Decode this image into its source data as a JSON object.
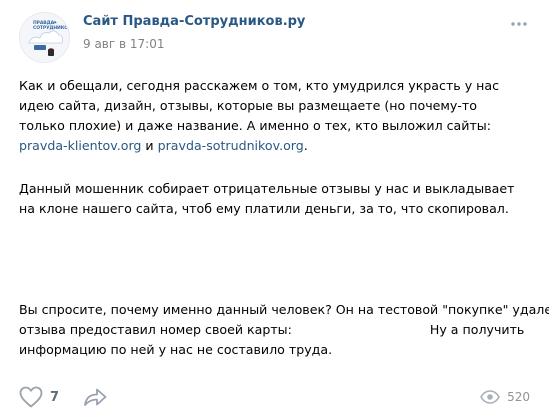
{
  "post": {
    "author": "Сайт Правда-Сотрудников.ру",
    "date": "9 авг в 17:01",
    "avatar_logo_text": "ПРАВДА\nСОТРУДНИКОВ",
    "paragraph1": {
      "text_before": "Как и обещали, сегодня расскажем о том, кто умудрился украсть у нас идею сайта, дизайн, отзывы, которые вы размещаете (но почему-то только плохие) и даже название. А именно о тех, кто выложил сайты: ",
      "link1": "pravda-klientov.org",
      "text_between": " и ",
      "link2": "pravda-sotrudnikov.org",
      "text_after": "."
    },
    "paragraph2": "Данный мошенник собирает отрицательные отзывы у нас и выкладывает на клоне нашего сайта, чтоб ему платили деньги, за то, что скопировал.",
    "paragraph3": {
      "line1": "Вы спросите, почему именно данный человек? Он на тестовой \"покупке\" удаления",
      "line2_a": "отзыва предоставил номер своей карты:",
      "line2_b": "Ну а получить",
      "line3": "информацию по ней у нас не составило труда."
    }
  },
  "actions": {
    "like_icon": "heart-icon",
    "like_count": "7",
    "share_icon": "share-arrow-icon",
    "views_icon": "eye-icon",
    "views_count": "520",
    "more_icon": "more-dots-icon"
  },
  "colors": {
    "link": "#2a5885",
    "meta": "#828282",
    "icon": "#99a2ad"
  }
}
